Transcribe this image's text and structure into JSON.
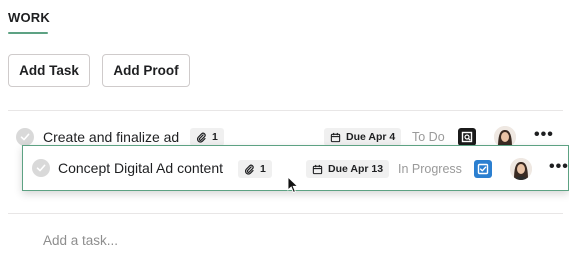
{
  "section": {
    "title": "WORK"
  },
  "toolbar": {
    "add_task_label": "Add Task",
    "add_proof_label": "Add Proof"
  },
  "tasks": [
    {
      "name": "Create and finalize ad",
      "attachments": "1",
      "due": "Due Apr 4",
      "status": "To Do",
      "app_icon": "proof-app-icon",
      "app_icon_color": "#1b1b1b",
      "more": "•••"
    },
    {
      "name": "Concept Digital Ad content",
      "attachments": "1",
      "due": "Due Apr 13",
      "status": "In Progress",
      "app_icon": "task-checkbox-app-icon",
      "app_icon_color": "#2b7fd0",
      "more": "•••"
    }
  ],
  "add_task_placeholder": "Add a task...",
  "colors": {
    "accent": "#5da283",
    "pill_bg": "#f0f0f0",
    "status_text": "#9a9a9a"
  }
}
